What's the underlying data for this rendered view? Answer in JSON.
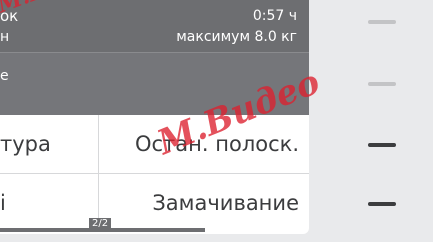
{
  "header": {
    "title_partial": "ок",
    "subtitle_partial": "н",
    "time": "0:57 ч",
    "max_load": "максимум 8.0 кг"
  },
  "subheader": {
    "text_partial": "е"
  },
  "options": [
    {
      "label": "тура"
    },
    {
      "label": "Остан. полоск."
    },
    {
      "label": "і"
    },
    {
      "label": "Замачивание"
    }
  ],
  "pagination": {
    "indicator": "2/2"
  },
  "watermark": {
    "text": "М.Видео",
    "color": "#dc202e"
  }
}
